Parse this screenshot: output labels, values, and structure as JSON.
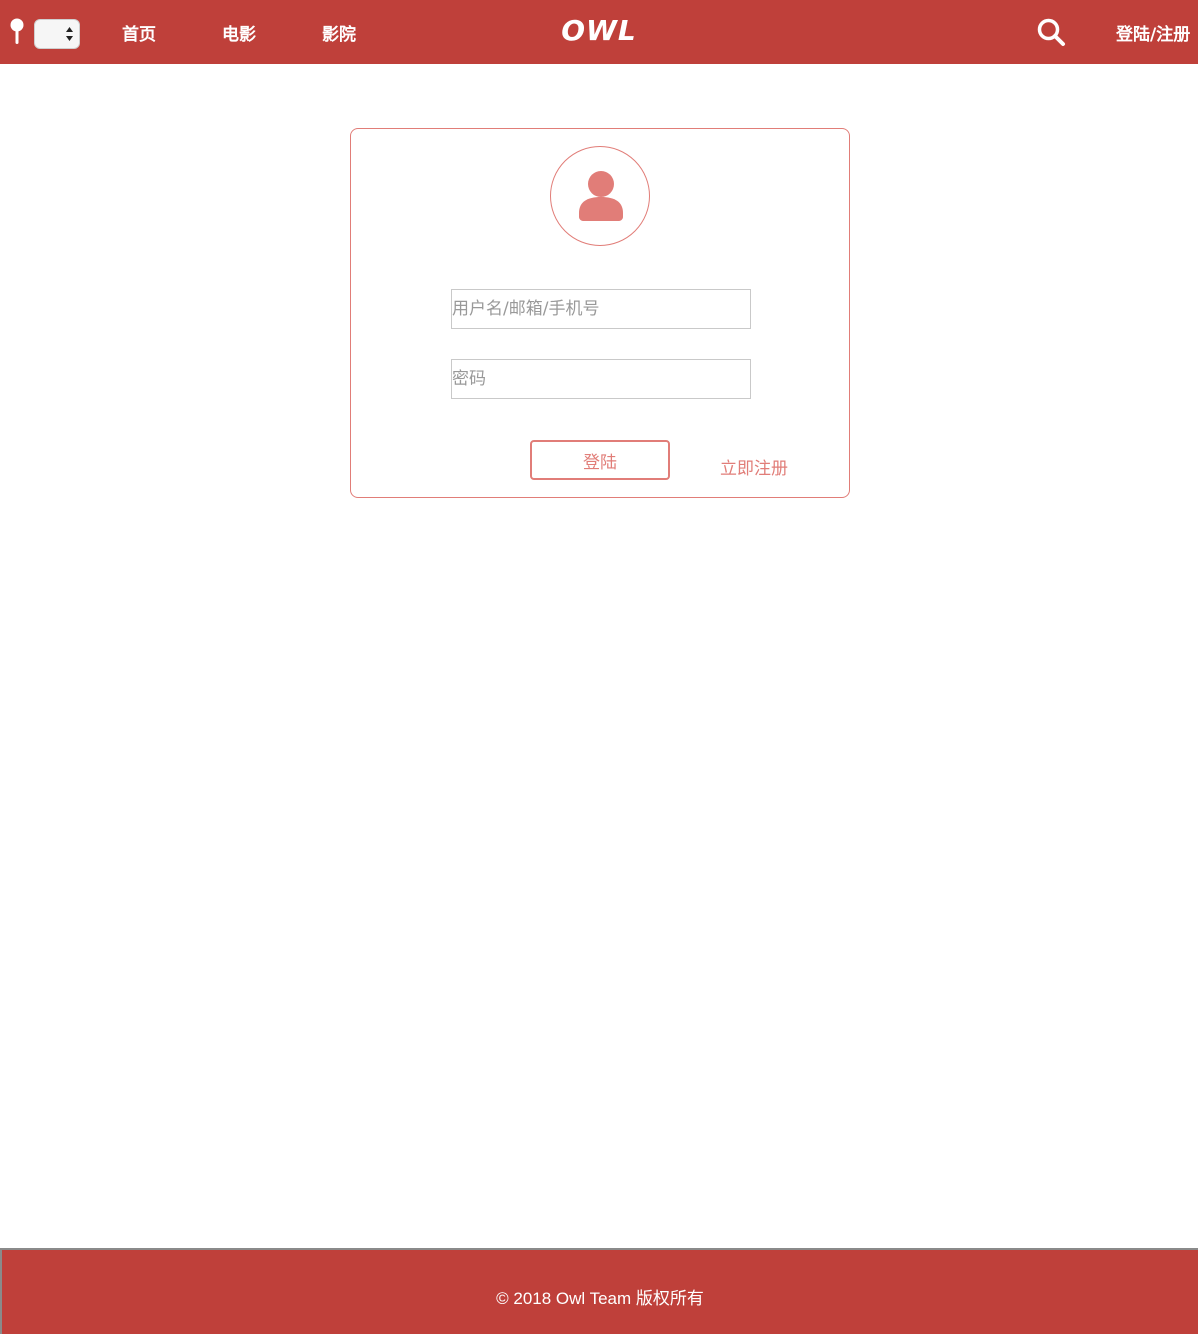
{
  "header": {
    "city_select_value": "",
    "nav": [
      {
        "label": "首页"
      },
      {
        "label": "电影"
      },
      {
        "label": "影院"
      }
    ],
    "logo": "OWL",
    "login_register": "登陆/注册",
    "icons": [
      "pin-icon",
      "search-icon"
    ]
  },
  "login_card": {
    "avatar_icon": "user-icon",
    "username_placeholder": "用户名/邮箱/手机号",
    "password_placeholder": "密码",
    "login_button": "登陆",
    "register_link": "立即注册"
  },
  "footer": {
    "copyright": "© 2018 Owl Team 版权所有"
  },
  "colors": {
    "brand": "#bf403a",
    "accent": "#e17d78"
  }
}
